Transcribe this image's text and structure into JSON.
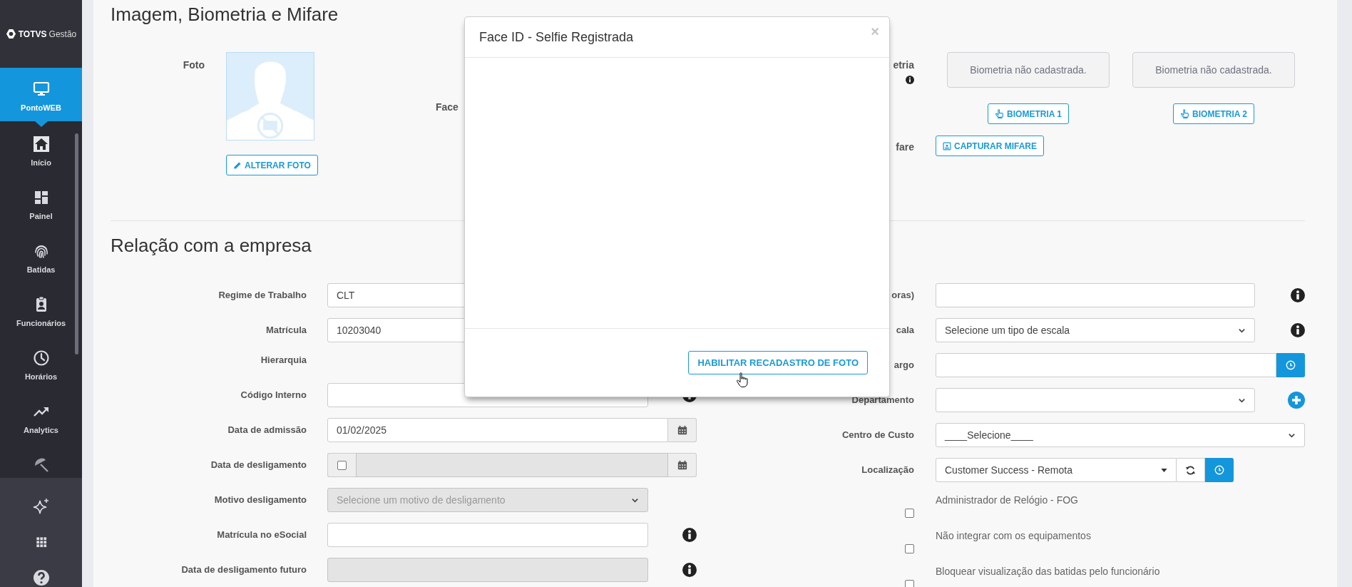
{
  "sidebar": {
    "brand": "TOTVS",
    "product": "Gestão",
    "items": [
      {
        "label": "PontoWEB",
        "selected": true
      },
      {
        "label": "Início",
        "selected": false
      },
      {
        "label": "Painel",
        "selected": false
      },
      {
        "label": "Batidas",
        "selected": false
      },
      {
        "label": "Funcionários",
        "selected": false
      },
      {
        "label": "Horários",
        "selected": false
      },
      {
        "label": "Analytics",
        "selected": false
      },
      {
        "selected": false
      }
    ]
  },
  "media_section": {
    "title": "Imagem, Biometria e Mifare",
    "photo_label": "Foto",
    "photo_button": "ALTERAR FOTO",
    "face_label": "Face",
    "biometrics_label": "etria",
    "biometrics": [
      {
        "status": "Biometria não cadastrada.",
        "button": "BIOMETRIA 1"
      },
      {
        "status": "Biometria não cadastrada.",
        "button": "BIOMETRIA 2"
      }
    ],
    "mifare_label": "fare",
    "mifare_button": "CAPTURAR MIFARE"
  },
  "company_section": {
    "title": "Relação com a empresa",
    "left_fields": [
      {
        "label": "Regime de Trabalho",
        "kind": "input",
        "value": "CLT",
        "disabled": false,
        "info": false
      },
      {
        "label": "Matrícula",
        "kind": "input",
        "value": "10203040",
        "disabled": false,
        "info": false
      },
      {
        "label": "Hierarquia",
        "kind": "text"
      },
      {
        "label": "Código Interno",
        "kind": "input",
        "disabled": false,
        "info": true
      },
      {
        "label": "Data de admissão",
        "kind": "date",
        "value": "01/02/2025",
        "disabled": false,
        "info": false
      },
      {
        "label": "Data de desligamento",
        "kind": "check_date",
        "checked": false,
        "disabled": true,
        "info": false
      },
      {
        "label": "Motivo desligamento",
        "kind": "select",
        "value": "Selecione um motivo de desligamento",
        "disabled": true,
        "info": false
      },
      {
        "label": "Matrícula no eSocial",
        "kind": "input",
        "disabled": false,
        "info": true
      },
      {
        "label": "Data de desligamento futuro",
        "kind": "input",
        "disabled": true,
        "info": true
      }
    ],
    "right_fields": [
      {
        "label": "oras)",
        "kind": "input",
        "disabled": false,
        "info": true
      },
      {
        "label": "cala",
        "kind": "select",
        "value": "Selecione um tipo de escala",
        "disabled": false,
        "info": true
      },
      {
        "label": "argo",
        "kind": "input_history",
        "disabled": false,
        "info": false
      },
      {
        "label": "Departamento",
        "kind": "select_add",
        "disabled": false,
        "info": false
      },
      {
        "label": "Centro de Custo",
        "kind": "select_wide",
        "value": "____Selecione____",
        "disabled": false,
        "info": false
      },
      {
        "label": "Localização",
        "kind": "combo",
        "value": "Customer Success - Remota",
        "disabled": false,
        "info": false
      },
      {
        "label": "Administrador de Relógio - FOG",
        "kind": "checkbox",
        "checked": false
      },
      {
        "label": "Não integrar com os equipamentos",
        "kind": "checkbox",
        "checked": false
      },
      {
        "label": "Bloquear visualização das batidas pelo funcionário",
        "kind": "checkbox",
        "checked": false
      }
    ]
  },
  "modal": {
    "title": "Face ID - Selfie Registrada",
    "close": "×",
    "button": "HABILITAR RECADASTRO DE FOTO"
  }
}
